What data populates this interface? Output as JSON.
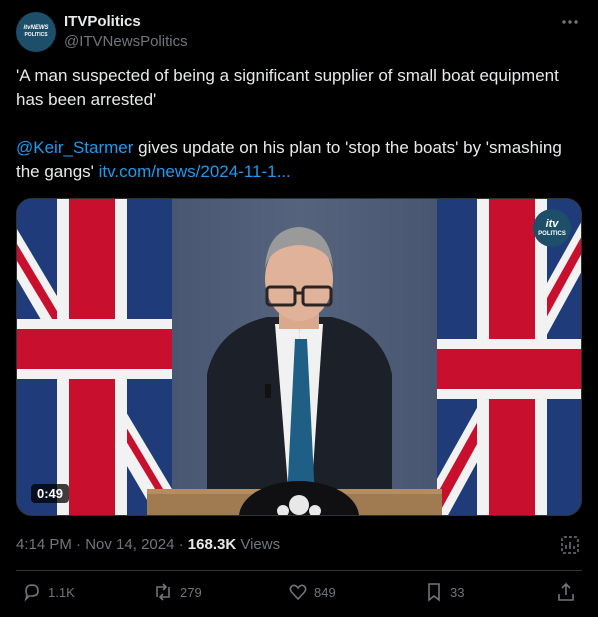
{
  "author": {
    "display_name": "ITVPolitics",
    "handle": "@ITVNewsPolitics",
    "avatar_line1": "itvNEWS",
    "avatar_line2": "POLITICS"
  },
  "tweet": {
    "line1": "'A man suspected of being a significant supplier of small boat equipment has been arrested'",
    "mention": "@Keir_Starmer",
    "line2_rest": " gives update on his plan to 'stop the boats' by 'smashing the gangs' ",
    "link": "itv.com/news/2024-11-1..."
  },
  "media": {
    "badge_line1": "itv",
    "badge_line2": "POLITICS",
    "duration": "0:49"
  },
  "meta": {
    "time": "4:14 PM",
    "date": "Nov 14, 2024",
    "views": "168.3K",
    "views_label": "Views"
  },
  "actions": {
    "replies": "1.1K",
    "reposts": "279",
    "likes": "849",
    "bookmarks": "33"
  },
  "icons": [
    "more-icon",
    "stats-icon",
    "reply-icon",
    "repost-icon",
    "like-icon",
    "bookmark-icon",
    "share-icon"
  ],
  "colors": {
    "link": "#1d9bf0",
    "muted": "#71767b",
    "text": "#e7e9ea",
    "background": "#000000"
  }
}
